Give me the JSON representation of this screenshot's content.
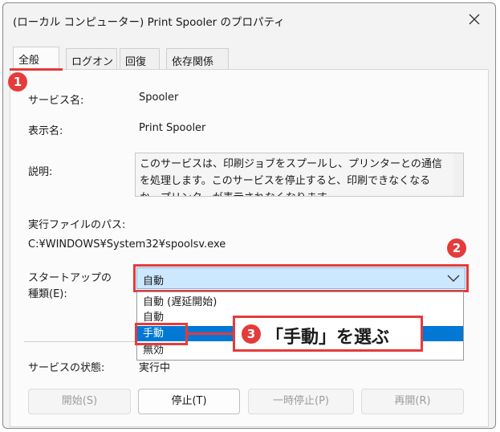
{
  "window": {
    "title": "(ローカル コンピューター) Print Spooler のプロパティ"
  },
  "tabs": [
    {
      "label": "全般"
    },
    {
      "label": "ログオン"
    },
    {
      "label": "回復"
    },
    {
      "label": "依存関係"
    }
  ],
  "general": {
    "service_name_label": "サービス名:",
    "service_name_value": "Spooler",
    "display_name_label": "表示名:",
    "display_name_value": "Print Spooler",
    "description_label": "説明:",
    "description_value": "このサービスは、印刷ジョブをスプールし、プリンターとの通信を処理します。このサービスを停止すると、印刷できなくなるか、プリンターが表示されなくなります。",
    "exe_path_label": "実行ファイルのパス:",
    "exe_path_value": "C:¥WINDOWS¥System32¥spoolsv.exe",
    "startup_type_label_line1": "スタートアップの",
    "startup_type_label_line2": "種類(E):",
    "startup_type_value": "自動",
    "startup_type_options": [
      "自動 (遅延開始)",
      "自動",
      "手動",
      "無効"
    ],
    "startup_type_highlighted": "手動",
    "service_status_label": "サービスの状態:",
    "service_status_value": "実行中"
  },
  "buttons": {
    "start": "開始(S)",
    "stop": "停止(T)",
    "pause": "一時停止(P)",
    "resume": "再開(R)"
  },
  "annotations": {
    "marker_1": "1",
    "marker_2": "2",
    "marker_3": "3",
    "callout_text": "「手動」を選ぶ"
  },
  "colors": {
    "annotation_red": "#e53b3b",
    "selection_blue": "#0078d4",
    "combo_highlight": "#cce8ff"
  }
}
